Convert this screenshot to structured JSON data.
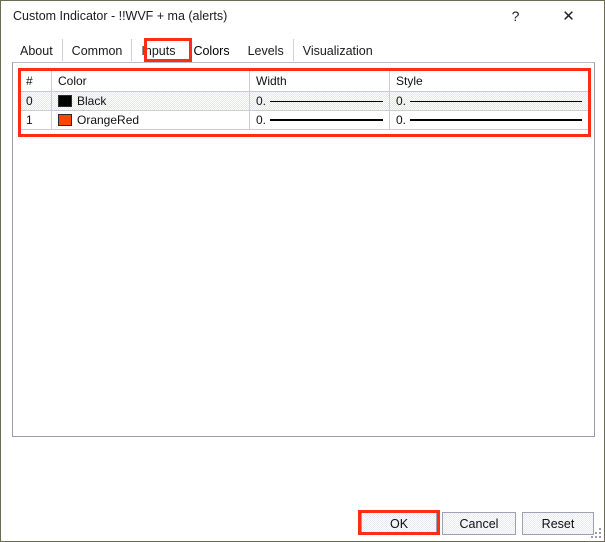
{
  "window": {
    "title": "Custom Indicator - !!WVF + ma (alerts)",
    "help_glyph": "?",
    "close_glyph": "✕"
  },
  "tabs": [
    {
      "label": "About",
      "active": false
    },
    {
      "label": "Common",
      "active": false
    },
    {
      "label": "Inputs",
      "active": false
    },
    {
      "label": "Colors",
      "active": true
    },
    {
      "label": "Levels",
      "active": false
    },
    {
      "label": "Visualization",
      "active": false
    }
  ],
  "table": {
    "headers": {
      "index": "#",
      "color": "Color",
      "width": "Width",
      "style": "Style"
    },
    "rows": [
      {
        "index": "0",
        "color_name": "Black",
        "color_hex": "#000000",
        "width_value": "0.",
        "style_value": "0.",
        "selected": true
      },
      {
        "index": "1",
        "color_name": "OrangeRed",
        "color_hex": "#FF4500",
        "width_value": "0.",
        "style_value": "0.",
        "selected": false
      }
    ]
  },
  "footer": {
    "ok": "OK",
    "cancel": "Cancel",
    "reset": "Reset"
  },
  "annotations": {
    "accent_color": "#FF2D16"
  }
}
